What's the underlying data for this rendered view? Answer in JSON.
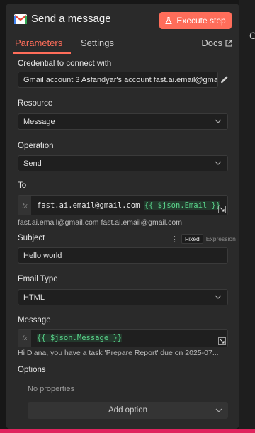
{
  "header": {
    "title": "Send a message",
    "execute_label": "Execute step"
  },
  "tabs": {
    "parameters": "Parameters",
    "settings": "Settings",
    "docs": "Docs"
  },
  "credential": {
    "label": "Credential to connect with",
    "value": "Gmail account 3 Asfandyar's account fast.ai.email@gma"
  },
  "resource": {
    "label": "Resource",
    "value": "Message"
  },
  "operation": {
    "label": "Operation",
    "value": "Send"
  },
  "to": {
    "label": "To",
    "static": "fast.ai.email@gmail.com ",
    "token": "{{ $json.Email }}",
    "hint": "fast.ai.email@gmail.com fast.ai.email@gmail.com"
  },
  "subject": {
    "label": "Subject",
    "value": "Hello world",
    "mode_fixed": "Fixed",
    "mode_expression": "Expression"
  },
  "email_type": {
    "label": "Email Type",
    "value": "HTML"
  },
  "message": {
    "label": "Message",
    "token": "{{ $json.Message }}",
    "hint": "Hi Diana, you have a task 'Prepare Report' due on 2025-07..."
  },
  "options": {
    "label": "Options",
    "empty": "No properties",
    "add_label": "Add option"
  },
  "colors": {
    "accent": "#ff6d5a",
    "token_green": "#5ad58b"
  }
}
